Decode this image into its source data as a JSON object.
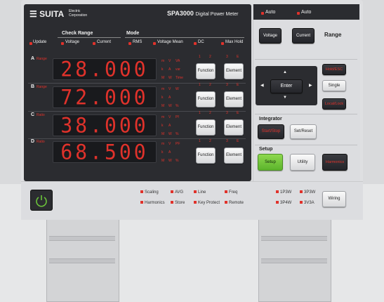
{
  "header": {
    "brand": "SUITA",
    "brand_sub1": "Electric",
    "brand_sub2": "Corporation",
    "model": "SPA3000",
    "model_desc": "Digital Power Meter"
  },
  "auto": [
    "Auto",
    "Auto"
  ],
  "check_range": {
    "title": "Check Range",
    "update": "Update",
    "voltage": "Voltage",
    "current": "Current"
  },
  "mode": {
    "title": "Mode",
    "rms": "RMS",
    "voltage_mean": "Voltage Mean",
    "dc": "DC",
    "max_hold": "Max Hold"
  },
  "range": {
    "title": "Range",
    "voltage": "Voltage",
    "current": "Current"
  },
  "rows": [
    {
      "letter": "A",
      "name": "Range",
      "value": "28.000",
      "units": [
        "m",
        "V",
        "VA",
        "k",
        "A",
        "var",
        "M",
        "W",
        "Time"
      ],
      "nums": [
        "1",
        "2",
        "3",
        "E"
      ]
    },
    {
      "letter": "B",
      "name": "Range",
      "value": "72.000",
      "units": [
        "m",
        "V",
        "W",
        "k",
        "A",
        "",
        "M",
        "W",
        "%"
      ],
      "nums": [
        "1",
        "2",
        "3",
        "E"
      ]
    },
    {
      "letter": "C",
      "name": "Ratio",
      "value": "38.000",
      "units": [
        "m",
        "V",
        "Pf",
        "k",
        "A",
        "",
        "M",
        "W",
        "%"
      ],
      "nums": [
        "1",
        "2",
        "3",
        "E"
      ]
    },
    {
      "letter": "D",
      "name": "Ratio",
      "value": "68.500",
      "units": [
        "m",
        "V",
        "PF",
        "k",
        "A",
        "",
        "M",
        "W",
        "%"
      ],
      "nums": [
        "1",
        "2",
        "3",
        "E"
      ]
    }
  ],
  "row_buttons": {
    "function": "Function",
    "element": "Element"
  },
  "nav": {
    "enter": "Enter",
    "up": "▲",
    "down": "▼",
    "left": "◀",
    "right": "▶",
    "hold": "Hold/ESC",
    "single": "Single",
    "local": "Local/Lock"
  },
  "integrator": {
    "title": "Integrator",
    "start": "Start/Stop",
    "set": "Set/Reset"
  },
  "setup": {
    "title": "Setup",
    "setup": "Setup",
    "utility": "Utility",
    "harmonics": "Harmonics"
  },
  "bottom": {
    "indicators": [
      "Scaling",
      "AVG",
      "Line",
      "Freq",
      "Harmonics",
      "Store",
      "Key Protect",
      "Remote"
    ],
    "wiring_ind": [
      "1P3W",
      "3P3W",
      "3P4W",
      "3V3A"
    ],
    "wiring": "Wiring"
  },
  "colors": {
    "accent": "#e0322b",
    "panel": "#2b2c30",
    "setup": "#6cc53a"
  }
}
